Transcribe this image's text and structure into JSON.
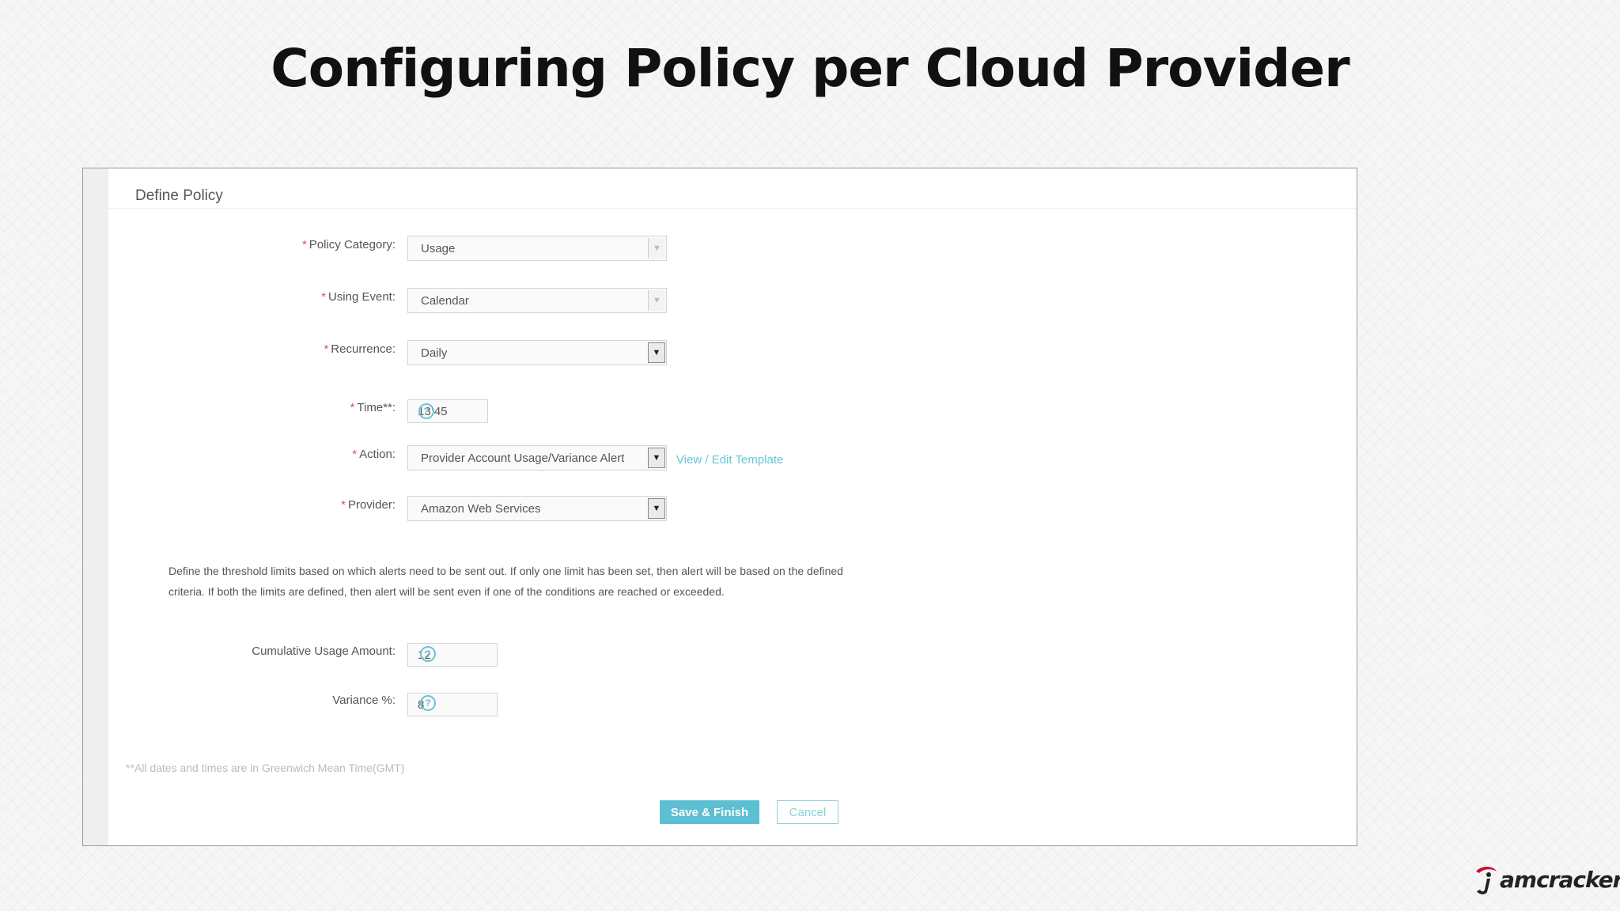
{
  "slide": {
    "title": "Configuring Policy per Cloud Provider"
  },
  "form": {
    "panel_title": "Define Policy",
    "required_mark": "*",
    "fields": {
      "policy_category": {
        "label": "Policy Category:",
        "value": "Usage"
      },
      "using_event": {
        "label": "Using Event:",
        "value": "Calendar"
      },
      "recurrence": {
        "label": "Recurrence:",
        "value": "Daily"
      },
      "time": {
        "label": "Time**:",
        "value": "13:45"
      },
      "action": {
        "label": "Action:",
        "value": "Provider Account Usage/Variance Alert",
        "link_text": "View / Edit Template"
      },
      "provider": {
        "label": "Provider:",
        "value": "Amazon Web Services"
      },
      "cumulative_usage": {
        "label": "Cumulative Usage Amount:",
        "value": "12"
      },
      "variance": {
        "label": "Variance %:",
        "value": "8"
      }
    },
    "description": "Define the threshold limits based on which alerts need to be sent out. If only one limit has been set, then alert will be based on the defined criteria. If both the limits are defined, then alert will be sent even if one of the conditions are reached or exceeded.",
    "footnote": "**All dates and times are in Greenwich Mean Time(GMT)",
    "buttons": {
      "save": "Save & Finish",
      "cancel": "Cancel"
    }
  },
  "icons": {
    "help": "?",
    "dropdown": "▼"
  },
  "brand": {
    "text": "amcracker"
  },
  "colors": {
    "accent": "#5cc0d2",
    "link": "#66c6d8",
    "required": "#d9534f",
    "brand_red": "#c8102e"
  }
}
